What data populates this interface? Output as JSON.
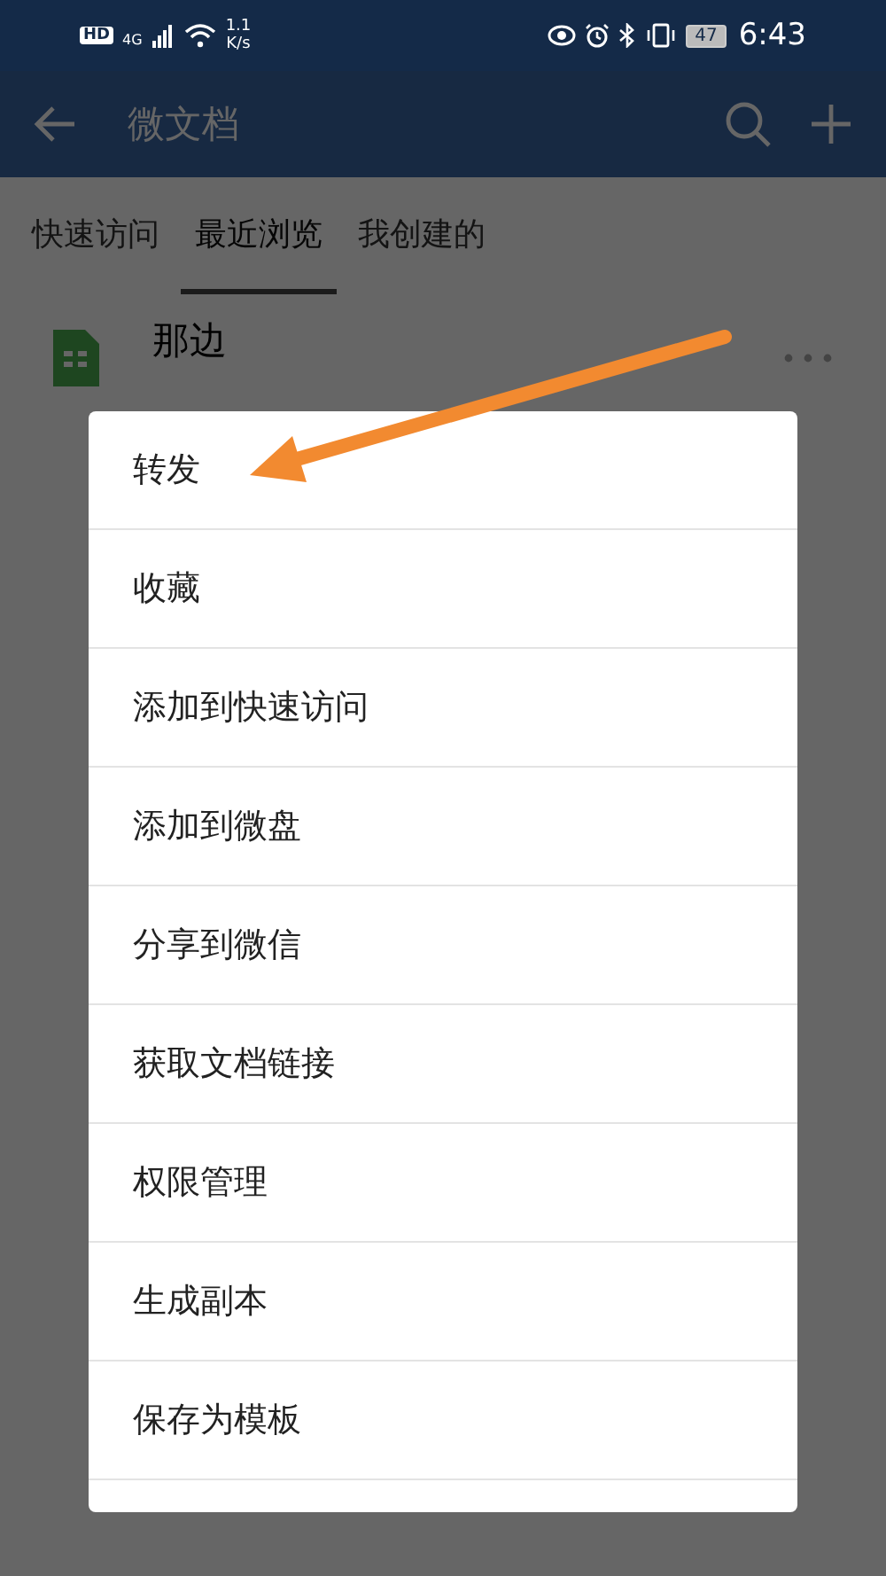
{
  "status_bar": {
    "hd": "HD",
    "network": "4G",
    "speed_value": "1.1",
    "speed_unit": "K/s",
    "battery": "47",
    "time": "6:43"
  },
  "header": {
    "title": "微文档"
  },
  "tabs": [
    {
      "label": "快速访问",
      "selected": false
    },
    {
      "label": "最近浏览",
      "selected": true
    },
    {
      "label": "我创建的",
      "selected": false
    }
  ],
  "documents": [
    {
      "name": "那边"
    }
  ],
  "menu": {
    "items": [
      "转发",
      "收藏",
      "添加到快速访问",
      "添加到微盘",
      "分享到微信",
      "获取文档链接",
      "权限管理",
      "生成副本",
      "保存为模板"
    ]
  }
}
